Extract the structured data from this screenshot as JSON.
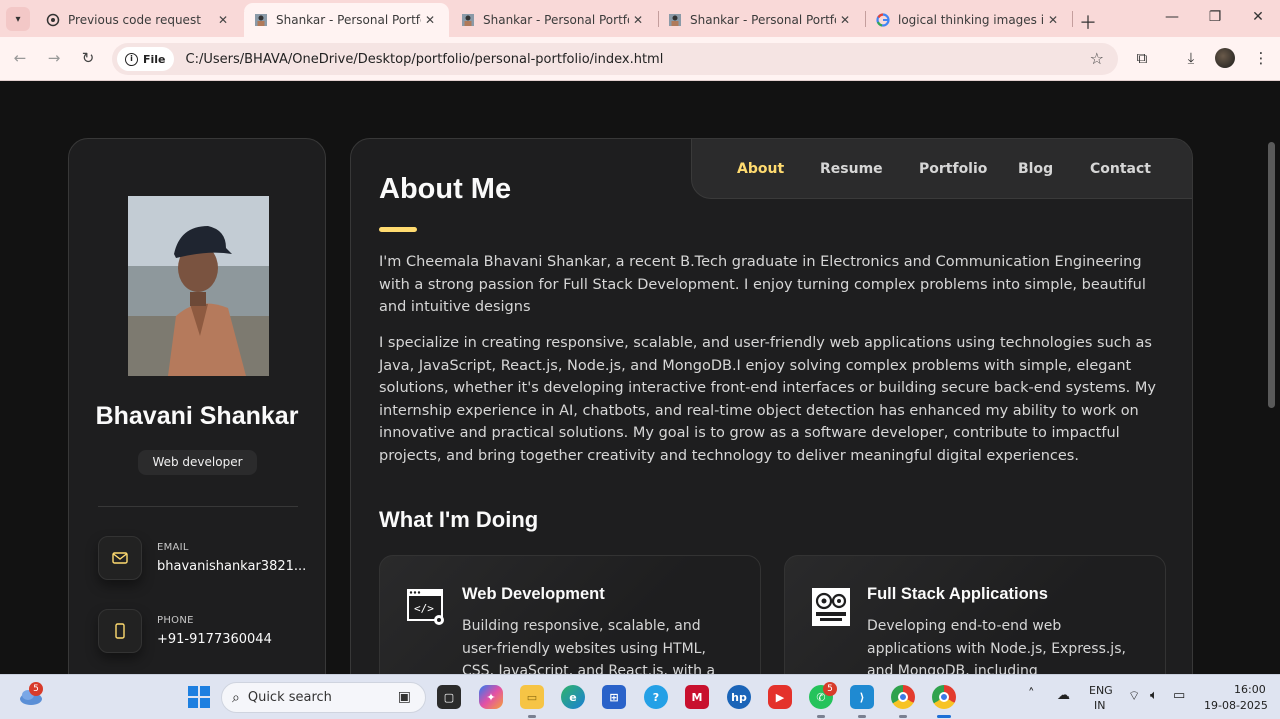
{
  "browser": {
    "tabs": [
      {
        "title": "Previous code request",
        "favicon": "openai-icon",
        "active": false
      },
      {
        "title": "Shankar - Personal Portfolio",
        "favicon": "page-thumbnail-icon",
        "active": true
      },
      {
        "title": "Shankar - Personal Portfolio",
        "favicon": "page-thumbnail-icon",
        "active": false
      },
      {
        "title": "Shankar - Personal Portfolio",
        "favicon": "page-thumbnail-icon",
        "active": false
      },
      {
        "title": "logical thinking images icon",
        "favicon": "google-icon",
        "active": false
      }
    ],
    "scheme_label": "File",
    "url": "C:/Users/BHAVA/OneDrive/Desktop/portfolio/personal-portfolio/index.html"
  },
  "sidebar": {
    "name": "Bhavani Shankar",
    "role": "Web developer",
    "contacts": [
      {
        "label": "EMAIL",
        "value": "bhavanishankar3821...",
        "icon": "mail-icon"
      },
      {
        "label": "PHONE",
        "value": "+91-9177360044",
        "icon": "phone-icon"
      }
    ]
  },
  "navbar": {
    "links": [
      "About",
      "Resume",
      "Portfolio",
      "Blog",
      "Contact"
    ],
    "active": "About"
  },
  "about": {
    "heading": "About Me",
    "paragraphs": [
      "I'm Cheemala Bhavani Shankar, a recent B.Tech graduate in Electronics and Communication Engineering with a strong passion for Full Stack Development. I enjoy turning complex problems into simple, beautiful and intuitive designs",
      "I specialize in creating responsive, scalable, and user-friendly web applications using technologies such as Java, JavaScript, React.js, Node.js, and MongoDB.I enjoy solving complex problems with simple, elegant solutions, whether it's developing interactive front-end interfaces or building secure back-end systems. My internship experience in AI, chatbots, and real-time object detection has enhanced my ability to work on innovative and practical solutions. My goal is to grow as a software developer, contribute to impactful projects, and bring together creativity and technology to deliver meaningful digital experiences."
    ]
  },
  "services": {
    "heading": "What I'm Doing",
    "items": [
      {
        "title": "Web Development",
        "text": "Building responsive, scalable, and user-friendly websites using HTML, CSS, JavaScript, and React.js, with a",
        "icon": "code-window-icon"
      },
      {
        "title": "Full Stack Applications",
        "text": "Developing end-to-end web applications with Node.js, Express.js, and MongoDB, including",
        "icon": "gears-monitor-icon"
      }
    ]
  },
  "taskbar": {
    "search_placeholder": "Quick search",
    "weather_badge": "5",
    "whatsapp_badge": "5",
    "language": "ENG",
    "region": "IN",
    "time": "16:00",
    "date": "19-08-2025"
  },
  "colors": {
    "accent": "#ffdb70",
    "page_bg": "#121212",
    "card_bg": "#1e1e1f",
    "tab_strip": "#f9d9d8"
  }
}
